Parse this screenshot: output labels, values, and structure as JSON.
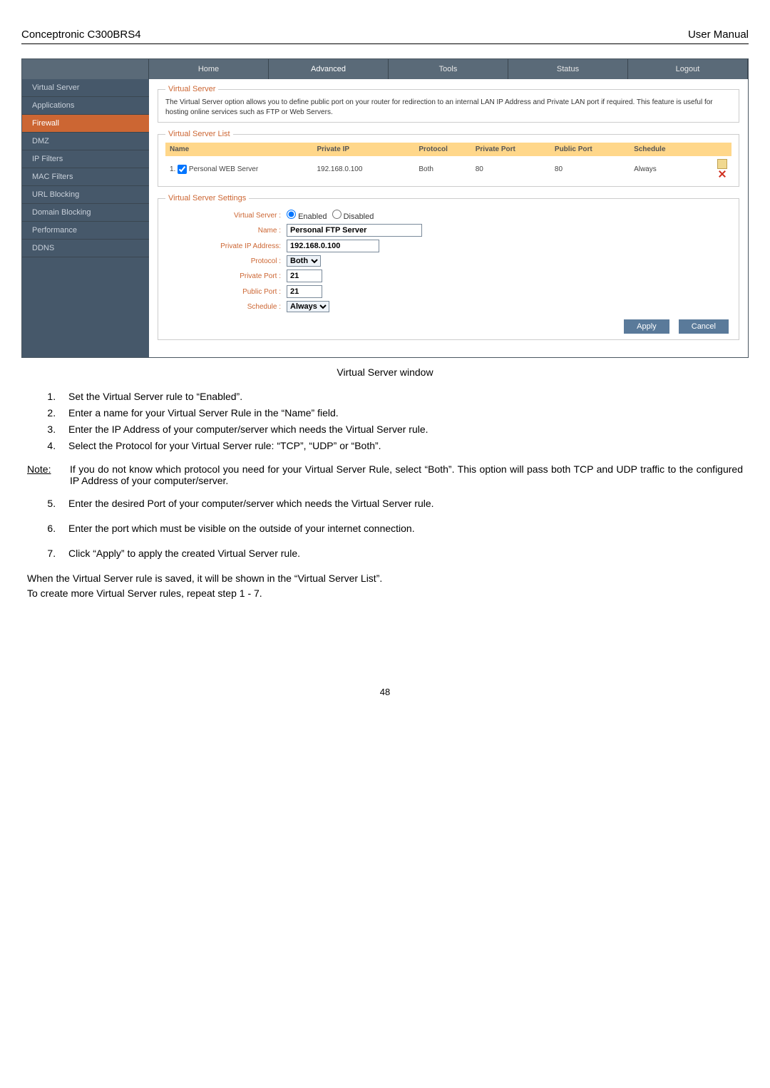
{
  "header": {
    "product": "Conceptronic C300BRS4",
    "doc_type": "User Manual"
  },
  "topnav": {
    "tabs": [
      "Home",
      "Advanced",
      "Tools",
      "Status",
      "Logout"
    ],
    "active_index": 1
  },
  "sidebar": {
    "items": [
      "Virtual Server",
      "Applications",
      "Firewall",
      "DMZ",
      "IP Filters",
      "MAC Filters",
      "URL Blocking",
      "Domain Blocking",
      "Performance",
      "DDNS"
    ],
    "active_index": 2
  },
  "virtual_server_section": {
    "legend": "Virtual Server",
    "description": "The Virtual Server option allows you to define public port on your router for redirection to an internal LAN IP Address and Private LAN port if required. This feature is useful for hosting online services such as FTP or Web Servers."
  },
  "vs_list": {
    "legend": "Virtual Server List",
    "headers": [
      "Name",
      "Private IP",
      "Protocol",
      "Private Port",
      "Public Port",
      "Schedule"
    ],
    "rows": [
      {
        "index": "1.",
        "checked": true,
        "name": "Personal WEB Server",
        "private_ip": "192.168.0.100",
        "protocol": "Both",
        "private_port": "80",
        "public_port": "80",
        "schedule": "Always"
      }
    ]
  },
  "vs_settings": {
    "legend": "Virtual Server Settings",
    "labels": {
      "virtual_server": "Virtual Server :",
      "name": "Name :",
      "private_ip": "Private IP Address:",
      "protocol": "Protocol :",
      "private_port": "Private Port :",
      "public_port": "Public Port :",
      "schedule": "Schedule :"
    },
    "radio": {
      "enabled_label": "Enabled",
      "disabled_label": "Disabled",
      "value": "enabled"
    },
    "values": {
      "name": "Personal FTP Server",
      "private_ip": "192.168.0.100",
      "protocol": "Both",
      "private_port": "21",
      "public_port": "21",
      "schedule": "Always"
    }
  },
  "buttons": {
    "apply": "Apply",
    "cancel": "Cancel"
  },
  "caption": "Virtual Server window",
  "instructions": {
    "items": [
      "Set the Virtual Server rule to “Enabled”.",
      "Enter a name for your Virtual Server Rule in the “Name” field.",
      "Enter the IP Address of your computer/server which needs the Virtual Server rule.",
      "Select the Protocol for your Virtual Server rule: “TCP”, “UDP” or “Both”."
    ]
  },
  "note": {
    "label": "Note:",
    "text": "If you do not know which protocol you need for your Virtual Server Rule, select “Both”. This option will pass both TCP and UDP traffic to the configured IP Address of your computer/server."
  },
  "instructions2": {
    "start": 5,
    "items": [
      "Enter the desired Port of your computer/server which needs the Virtual Server rule.",
      "Enter the port which must be visible on the outside of your internet connection.",
      "Click “Apply” to apply the created Virtual Server rule."
    ]
  },
  "closing": {
    "line1": "When the Virtual Server rule is saved, it will be shown in the “Virtual Server List”.",
    "line2": "To create more Virtual Server rules, repeat step 1 - 7."
  },
  "page_number": "48"
}
